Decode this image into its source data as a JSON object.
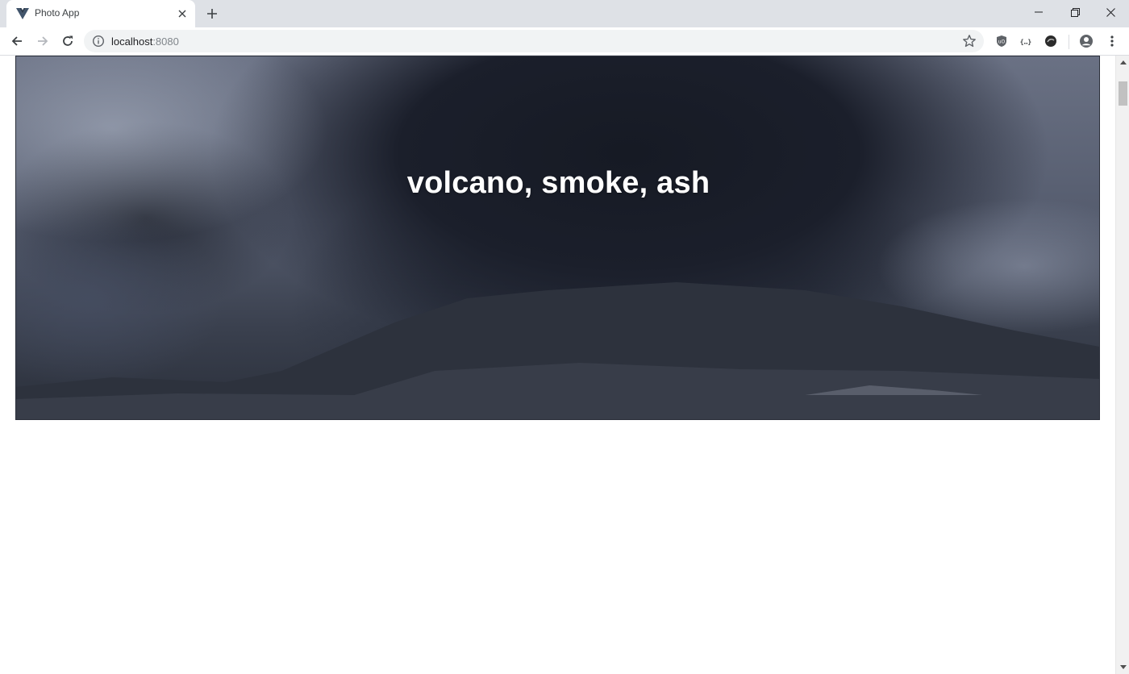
{
  "browser": {
    "tab": {
      "title": "Photo App",
      "favicon": "vue-logo-icon"
    },
    "url": {
      "host": "localhost",
      "port": ":8080"
    },
    "icons": {
      "back": "arrow-left-icon",
      "forward": "arrow-right-icon",
      "reload": "reload-icon",
      "site_info": "info-icon",
      "bookmark": "star-icon",
      "extensions": [
        "ublock-icon",
        "json-viewer-icon",
        "obsidian-icon"
      ],
      "profile": "profile-icon",
      "menu": "kebab-menu-icon"
    }
  },
  "hero": {
    "title": "volcano, smoke, ash",
    "image": "volcano-eruption-photo"
  },
  "colors": {
    "tabstrip": "#dee1e6",
    "omnibox": "#f1f3f4",
    "hero_dark": "#161a24",
    "title_text": "#ffffff"
  }
}
